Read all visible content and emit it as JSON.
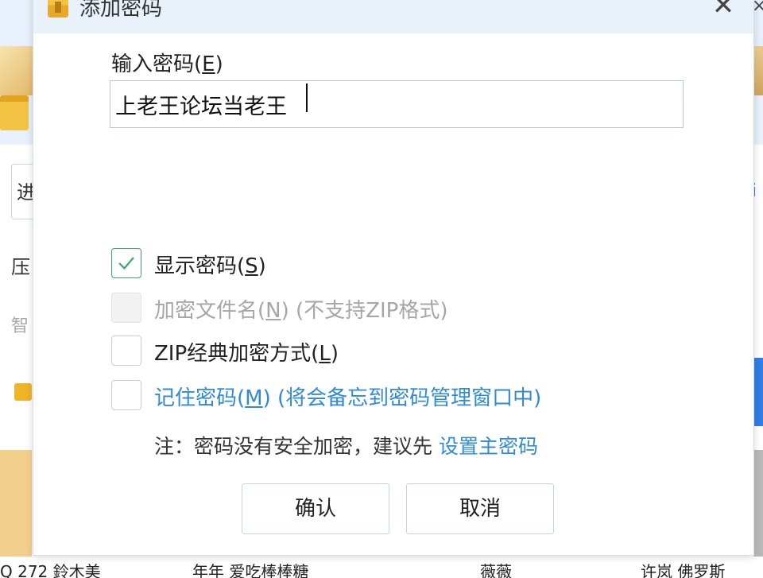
{
  "dialog": {
    "title": "添加密码",
    "password_label": "输入密码(",
    "password_label_key": "E",
    "password_label_end": ")",
    "password_value": "上老王论坛当老王",
    "options": [
      {
        "label": "显示密码(",
        "key": "S",
        "suffix": ")",
        "checked": true,
        "disabled": false
      },
      {
        "label": "加密文件名(",
        "key": "N",
        "suffix": ") (不支持ZIP格式)",
        "checked": false,
        "disabled": true
      },
      {
        "label": "ZIP经典加密方式(",
        "key": "L",
        "suffix": ")",
        "checked": false,
        "disabled": false
      },
      {
        "label": "记住密码(",
        "key": "M",
        "suffix": ") (将会备忘到密码管理窗口中)",
        "checked": false,
        "disabled": false
      }
    ],
    "note_text": "注：密码没有安全加密，建议先",
    "note_link": "设置主密码",
    "ok_label": "确认",
    "cancel_label": "取消",
    "close_glyph": "✕"
  },
  "background": {
    "search_fragment": "进",
    "label_fragment_1": "压",
    "label_fragment_2": "智",
    "bottom_texts": [
      "Q 272 鈴木美",
      "年年 爱吃棒棒糖",
      "薇薇",
      "许岚 佛罗斯"
    ]
  },
  "colors": {
    "titlebar": "#e9f1fb",
    "checkmark": "#38a86b",
    "link": "#2f8ad8"
  }
}
